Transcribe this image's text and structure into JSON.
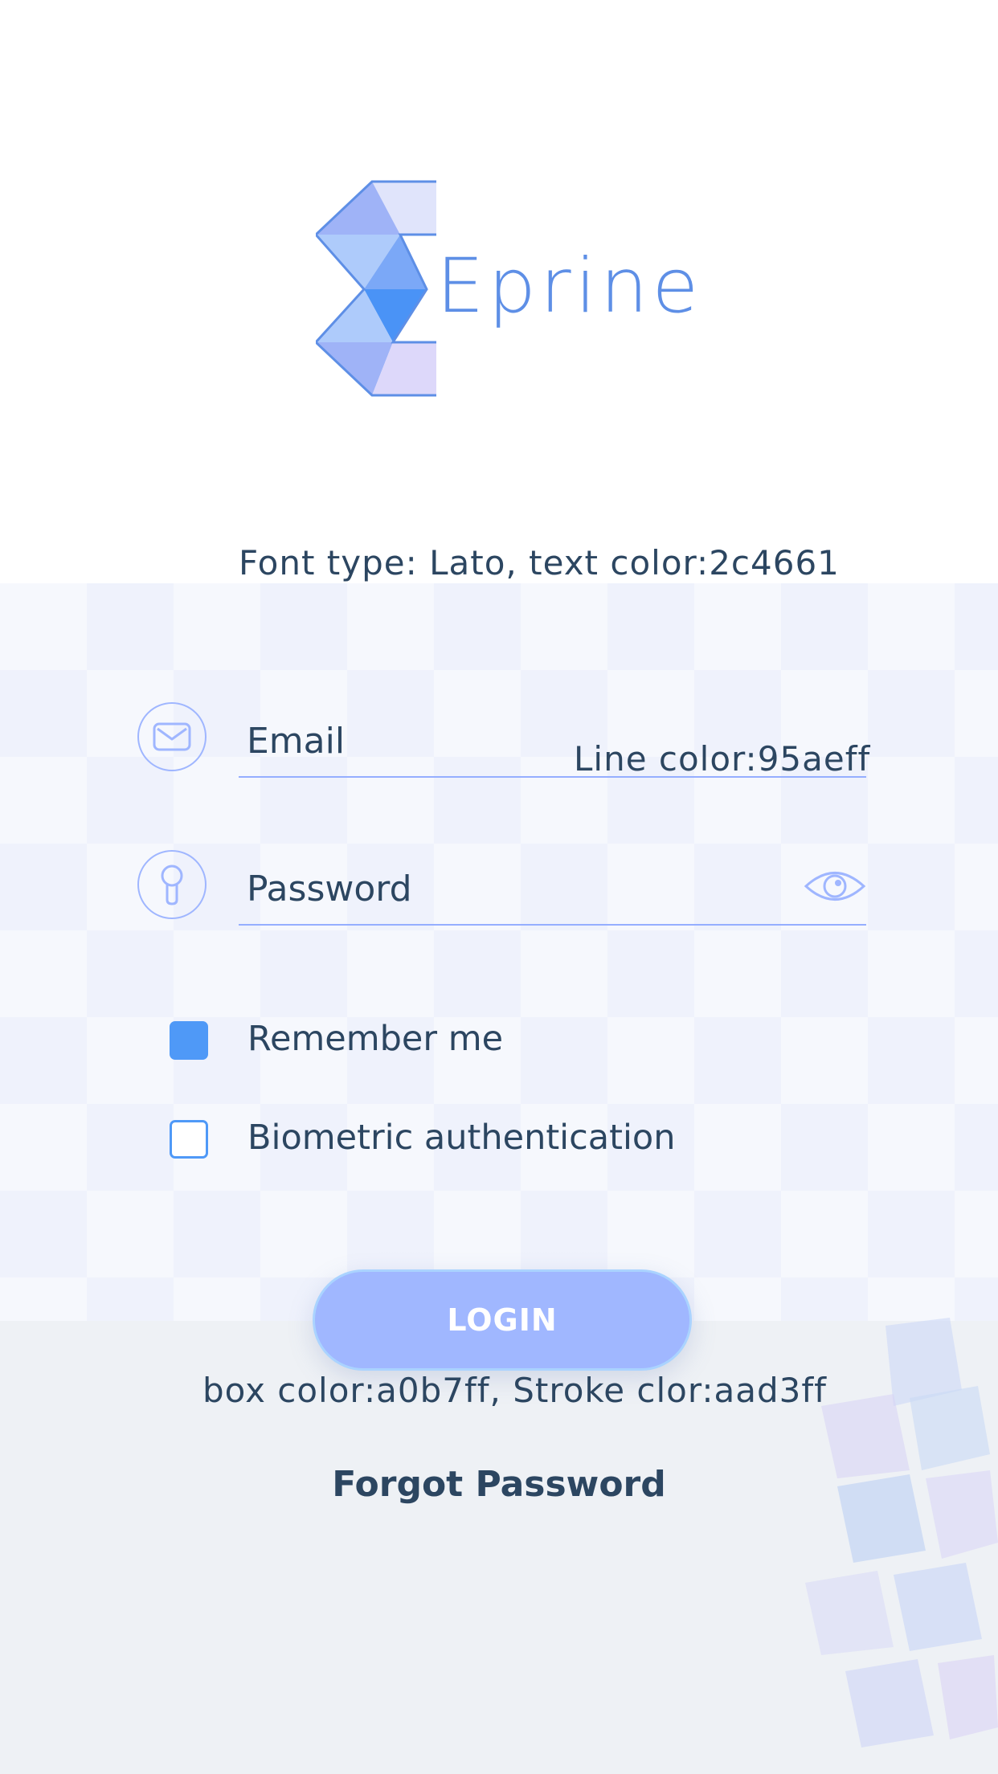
{
  "logo": {
    "wordmark": "Eprine"
  },
  "notes": {
    "font": "Font type: Lato, text color:2c4661",
    "line": "Line color:95aeff",
    "box": "box color:a0b7ff, Stroke clor:aad3ff"
  },
  "form": {
    "email": {
      "placeholder": "Email",
      "value": ""
    },
    "password": {
      "placeholder": "Password",
      "value": ""
    },
    "remember": {
      "label": "Remember me",
      "checked": true
    },
    "biometric": {
      "label": "Biometric authentication",
      "checked": false
    },
    "login_label": "LOGIN",
    "forgot_label": "Forgot Password"
  },
  "icons": {
    "email": "envelope-icon",
    "password": "keyhole-icon",
    "reveal": "eye-icon"
  },
  "colors": {
    "text": "#2c4661",
    "line": "#95aeff",
    "button": "#a0b7ff",
    "button_stroke": "#aad3ff",
    "checkbox": "#4f99f7"
  }
}
